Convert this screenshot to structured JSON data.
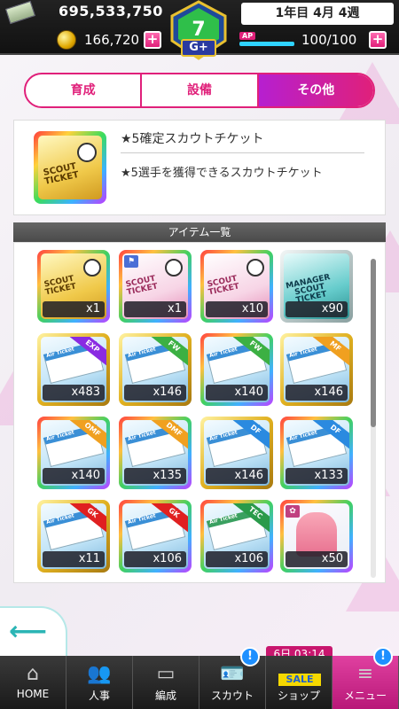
{
  "status": {
    "money": "695,533,750",
    "coins": "166,720",
    "date": "1年目 4月 4週",
    "ap_label": "AP",
    "ap_value": "100/100",
    "ap_fraction": 1.0,
    "plus": "+",
    "rank": "G+"
  },
  "tabs": [
    {
      "label": "育成",
      "active": false
    },
    {
      "label": "設備",
      "active": false
    },
    {
      "label": "その他",
      "active": true
    }
  ],
  "selected": {
    "name": "★5確定スカウトチケット",
    "desc": "★5選手を獲得できるスカウトチケット",
    "ticket_text": "SCOUT\nTICKET"
  },
  "list": {
    "title": "アイテム一覧",
    "items": [
      {
        "qty": "x1",
        "frame": "rainbow",
        "face": "yellow",
        "kind": "scout",
        "text": "SCOUT\nTICKET"
      },
      {
        "qty": "x1",
        "frame": "rainbow",
        "face": "pink",
        "kind": "scout",
        "text": "SCOUT\nTICKET",
        "mini": "flag"
      },
      {
        "qty": "x10",
        "frame": "rainbow",
        "face": "pink",
        "kind": "scout",
        "text": "SCOUT\nTICKET"
      },
      {
        "qty": "x90",
        "frame": "silver",
        "face": "teal",
        "kind": "manager",
        "text": "MANAGER\nSCOUT\nTICKET"
      },
      {
        "qty": "x483",
        "frame": "gold",
        "face": "blue",
        "kind": "air",
        "ribbon": "EXP",
        "ribbon_color": "#8a2be2"
      },
      {
        "qty": "x146",
        "frame": "gold",
        "face": "blue",
        "kind": "air",
        "ribbon": "FW",
        "ribbon_color": "#3cb043"
      },
      {
        "qty": "x140",
        "frame": "rainbow",
        "face": "blue",
        "kind": "air",
        "ribbon": "FW",
        "ribbon_color": "#3cb043"
      },
      {
        "qty": "x146",
        "frame": "gold",
        "face": "blue",
        "kind": "air",
        "ribbon": "MF",
        "ribbon_color": "#f0a020"
      },
      {
        "qty": "x140",
        "frame": "rainbow",
        "face": "blue",
        "kind": "air",
        "ribbon": "OMF",
        "ribbon_color": "#f0a020"
      },
      {
        "qty": "x135",
        "frame": "rainbow",
        "face": "blue",
        "kind": "air",
        "ribbon": "DMF",
        "ribbon_color": "#f0a020"
      },
      {
        "qty": "x146",
        "frame": "gold",
        "face": "blue",
        "kind": "air",
        "ribbon": "DF",
        "ribbon_color": "#2a8ae0"
      },
      {
        "qty": "x133",
        "frame": "rainbow",
        "face": "blue",
        "kind": "air",
        "ribbon": "DF",
        "ribbon_color": "#2a8ae0"
      },
      {
        "qty": "x11",
        "frame": "gold",
        "face": "blue",
        "kind": "air",
        "ribbon": "GK",
        "ribbon_color": "#e02020"
      },
      {
        "qty": "x106",
        "frame": "rainbow",
        "face": "blue",
        "kind": "air",
        "ribbon": "GK",
        "ribbon_color": "#e02020"
      },
      {
        "qty": "x106",
        "frame": "rainbow",
        "face": "blue",
        "kind": "air_green",
        "ribbon": "TEC",
        "ribbon_color": "#2a9a4a"
      },
      {
        "qty": "x50",
        "frame": "rainbow",
        "face": "dress",
        "kind": "dress",
        "mini": "dress"
      }
    ],
    "air_text": "Air Ticket"
  },
  "nav": [
    {
      "label": "HOME",
      "icon": "home-icon",
      "glyph": "⌂"
    },
    {
      "label": "人事",
      "icon": "people-icon",
      "glyph": "👥"
    },
    {
      "label": "編成",
      "icon": "field-icon",
      "glyph": "▭"
    },
    {
      "label": "スカウト",
      "icon": "badge-icon",
      "glyph": "🪪",
      "bang": "!"
    },
    {
      "label": "ショップ",
      "icon": "shop-icon",
      "glyph": "",
      "sale": "SALE"
    },
    {
      "label": "メニュー",
      "icon": "menu-icon",
      "glyph": "≡",
      "bang": "!",
      "active": true
    }
  ],
  "timer": "6日 03:14",
  "back_icon": "arrow-left-icon"
}
